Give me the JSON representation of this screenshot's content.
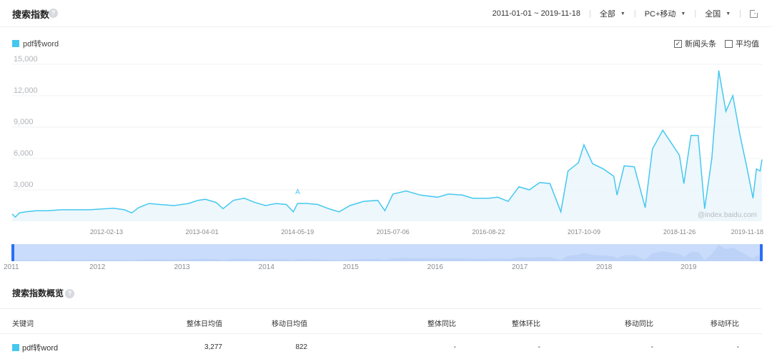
{
  "header": {
    "title": "搜索指数",
    "date_range": "2011-01-01 ~ 2019-11-18",
    "source_filter": "全部",
    "device_filter": "PC+移动",
    "region_filter": "全国"
  },
  "legend": {
    "keyword": "pdf转word",
    "color": "#45c8f0"
  },
  "options": {
    "news_label": "新闻头条",
    "news_checked": true,
    "average_label": "平均值",
    "average_checked": false
  },
  "chart_data": {
    "type": "area",
    "yticks": [
      "15,000",
      "12,000",
      "9,000",
      "6,000",
      "3,000"
    ],
    "ylim": [
      0,
      15000
    ],
    "xlim": [
      "2011-01-01",
      "2019-11-18"
    ],
    "xtick_labels": [
      "2012-02-13",
      "2013-04-01",
      "2014-05-19",
      "2015-07-06",
      "2016-08-22",
      "2017-10-09",
      "2018-11-26",
      "2019-11-18"
    ],
    "annotation": "A",
    "watermark": "@index.baidu.com",
    "series": [
      {
        "name": "pdf转word",
        "color": "#45c8f0",
        "points": [
          [
            "2011-01-01",
            700
          ],
          [
            "2011-01-15",
            400
          ],
          [
            "2011-02-01",
            800
          ],
          [
            "2011-03-01",
            900
          ],
          [
            "2011-04-15",
            1000
          ],
          [
            "2011-06-01",
            1000
          ],
          [
            "2011-08-01",
            1100
          ],
          [
            "2011-10-01",
            1100
          ],
          [
            "2011-12-01",
            1100
          ],
          [
            "2012-02-13",
            1200
          ],
          [
            "2012-03-15",
            1250
          ],
          [
            "2012-05-01",
            1100
          ],
          [
            "2012-06-01",
            800
          ],
          [
            "2012-07-01",
            1300
          ],
          [
            "2012-08-15",
            1700
          ],
          [
            "2012-10-01",
            1600
          ],
          [
            "2012-12-01",
            1500
          ],
          [
            "2013-02-01",
            1700
          ],
          [
            "2013-03-15",
            2000
          ],
          [
            "2013-04-15",
            2100
          ],
          [
            "2013-06-01",
            1800
          ],
          [
            "2013-07-01",
            1200
          ],
          [
            "2013-08-15",
            2000
          ],
          [
            "2013-10-01",
            2200
          ],
          [
            "2013-11-15",
            1800
          ],
          [
            "2014-01-01",
            1500
          ],
          [
            "2014-02-15",
            1700
          ],
          [
            "2014-04-01",
            1600
          ],
          [
            "2014-05-01",
            900
          ],
          [
            "2014-05-19",
            1700
          ],
          [
            "2014-07-01",
            1700
          ],
          [
            "2014-08-15",
            1600
          ],
          [
            "2014-10-01",
            1200
          ],
          [
            "2014-11-15",
            900
          ],
          [
            "2015-01-01",
            1500
          ],
          [
            "2015-03-01",
            1900
          ],
          [
            "2015-05-01",
            2000
          ],
          [
            "2015-06-01",
            1000
          ],
          [
            "2015-07-06",
            2600
          ],
          [
            "2015-09-01",
            2900
          ],
          [
            "2015-11-01",
            2500
          ],
          [
            "2016-01-15",
            2300
          ],
          [
            "2016-03-01",
            2600
          ],
          [
            "2016-05-01",
            2500
          ],
          [
            "2016-06-15",
            2200
          ],
          [
            "2016-08-22",
            2200
          ],
          [
            "2016-10-01",
            2300
          ],
          [
            "2016-11-15",
            1900
          ],
          [
            "2017-01-01",
            3300
          ],
          [
            "2017-02-15",
            3000
          ],
          [
            "2017-04-01",
            3700
          ],
          [
            "2017-05-15",
            3600
          ],
          [
            "2017-07-01",
            900
          ],
          [
            "2017-08-01",
            4800
          ],
          [
            "2017-09-15",
            5600
          ],
          [
            "2017-10-09",
            7300
          ],
          [
            "2017-11-15",
            5500
          ],
          [
            "2018-01-01",
            5000
          ],
          [
            "2018-02-15",
            4300
          ],
          [
            "2018-03-01",
            2500
          ],
          [
            "2018-04-01",
            5300
          ],
          [
            "2018-05-15",
            5200
          ],
          [
            "2018-07-01",
            1300
          ],
          [
            "2018-08-01",
            6900
          ],
          [
            "2018-09-15",
            8700
          ],
          [
            "2018-10-15",
            7700
          ],
          [
            "2018-11-26",
            6300
          ],
          [
            "2018-12-15",
            3600
          ],
          [
            "2019-01-15",
            8200
          ],
          [
            "2019-02-15",
            8200
          ],
          [
            "2019-03-15",
            1200
          ],
          [
            "2019-04-15",
            6000
          ],
          [
            "2019-05-15",
            14400
          ],
          [
            "2019-06-15",
            10500
          ],
          [
            "2019-07-15",
            12000
          ],
          [
            "2019-08-15",
            8200
          ],
          [
            "2019-09-15",
            5000
          ],
          [
            "2019-10-10",
            2200
          ],
          [
            "2019-10-25",
            5000
          ],
          [
            "2019-11-10",
            4800
          ],
          [
            "2019-11-18",
            5900
          ]
        ]
      }
    ]
  },
  "slider": {
    "years": [
      "2011",
      "2012",
      "2013",
      "2014",
      "2015",
      "2016",
      "2017",
      "2018",
      "2019"
    ]
  },
  "summary": {
    "title": "搜索指数概览",
    "columns": [
      "关键词",
      "整体日均值",
      "移动日均值",
      "整体同比",
      "整体环比",
      "移动同比",
      "移动环比"
    ],
    "row": {
      "keyword": "pdf转word",
      "overall_daily_avg": "3,277",
      "mobile_daily_avg": "822",
      "overall_yoy": "-",
      "overall_mom": "-",
      "mobile_yoy": "-",
      "mobile_mom": "-"
    }
  }
}
